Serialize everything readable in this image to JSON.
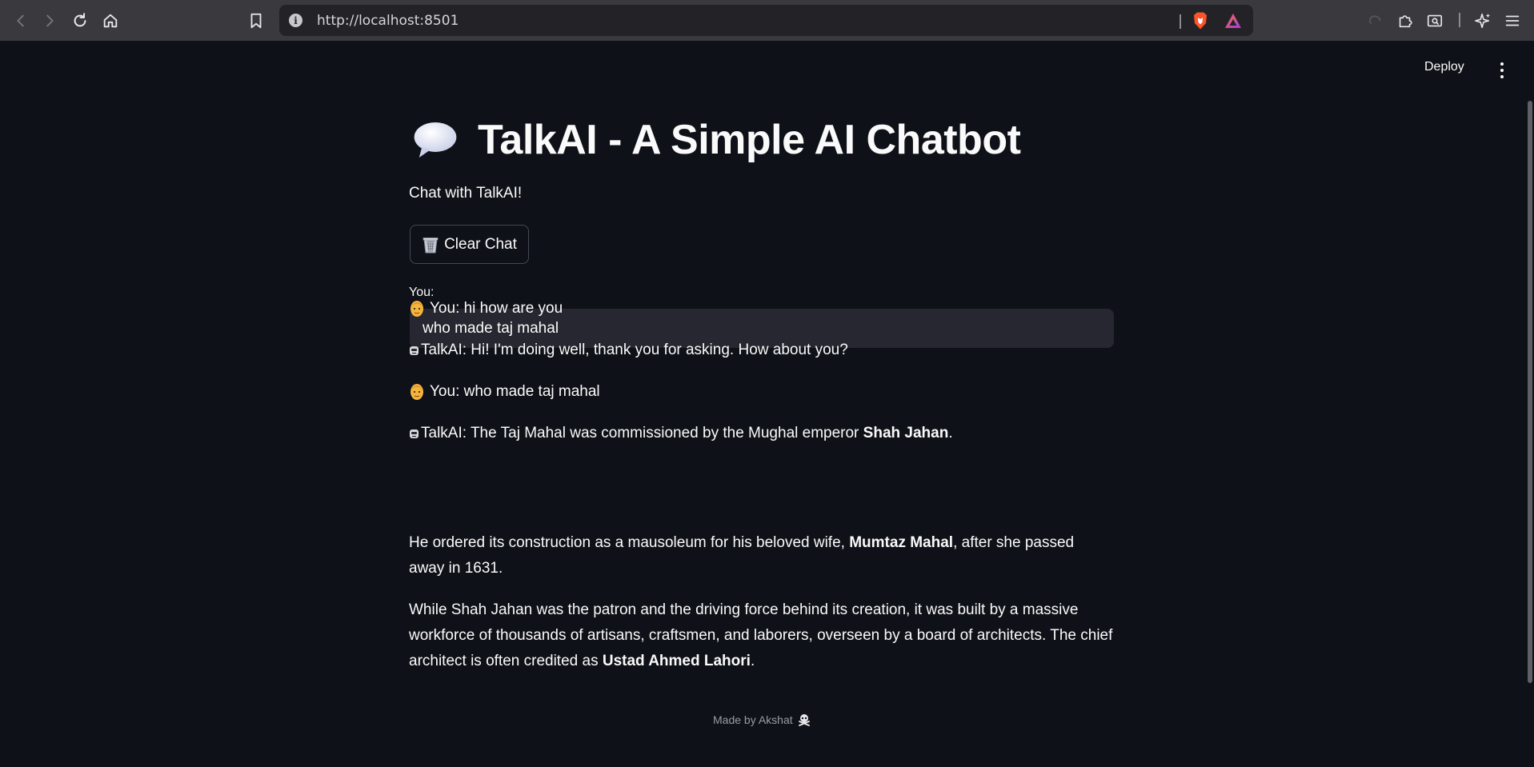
{
  "browser": {
    "url": "http://localhost:8501"
  },
  "app_header": {
    "deploy_label": "Deploy"
  },
  "main": {
    "title": "TalkAI - A Simple AI Chatbot",
    "subtitle": "Chat with TalkAI!",
    "clear_button_label": "Clear Chat",
    "input_label": "You:",
    "input_value": "who made taj mahal"
  },
  "messages": [
    {
      "role": "user",
      "text": "You: hi how are you"
    },
    {
      "role": "bot",
      "text": "TalkAI: Hi! I'm doing well, thank you for asking. How about you?"
    },
    {
      "role": "user",
      "text": "You: who made taj mahal"
    },
    {
      "role": "bot",
      "prefix": "TalkAI: The Taj Mahal was commissioned by the Mughal emperor ",
      "bold": "Shah Jahan",
      "suffix": "."
    }
  ],
  "answer_paragraphs": {
    "p1_prefix": "He ordered its construction as a mausoleum for his beloved wife, ",
    "p1_bold": "Mumtaz Mahal",
    "p1_suffix": ", after she passed away in 1631.",
    "p2_prefix": "While Shah Jahan was the patron and the driving force behind its creation, it was built by a massive workforce of thousands of artisans, craftsmen, and laborers, overseen by a board of architects. The chief architect is often credited as ",
    "p2_bold": "Ustad Ahmed Lahori",
    "p2_suffix": "."
  },
  "footer": {
    "text": "Made by Akshat"
  },
  "icons": {
    "title": "speech-balloon-icon",
    "clear": "wastebasket-icon",
    "user": "person-icon",
    "bot": "robot-face-icon",
    "footer": "skull-crossbones-icon"
  }
}
